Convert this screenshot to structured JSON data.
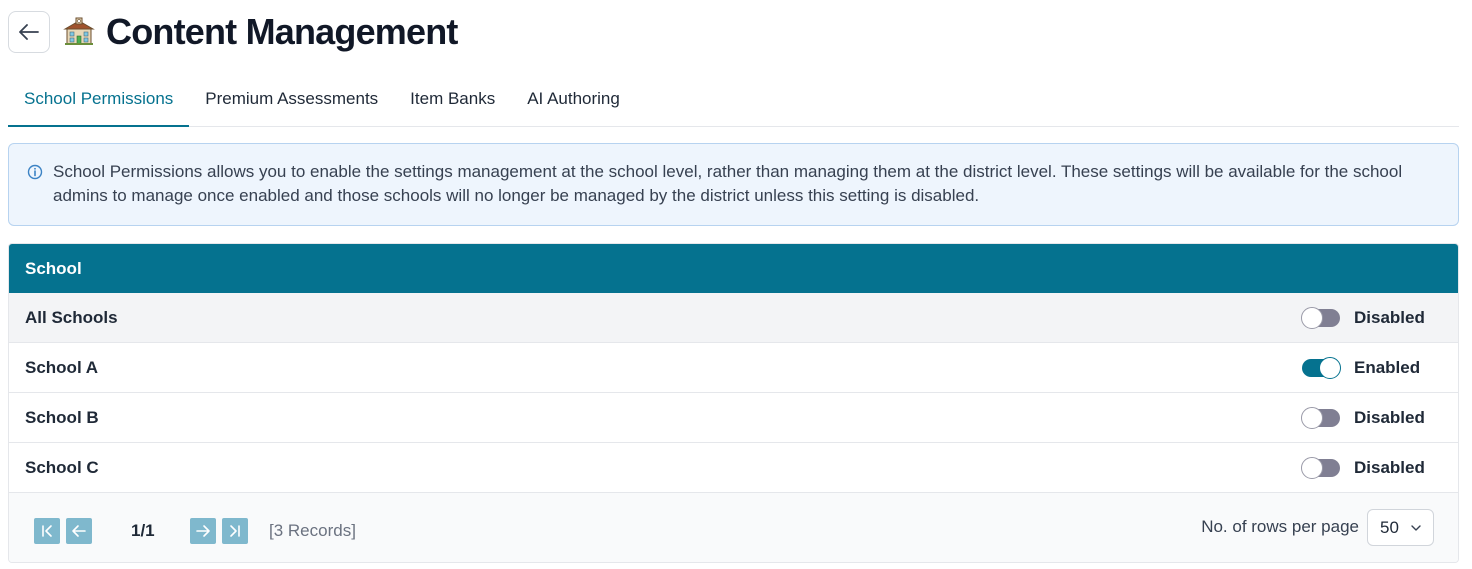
{
  "header": {
    "title": "Content Management",
    "back_icon": "arrow-left-icon",
    "title_icon": "school-building-icon"
  },
  "tabs": [
    {
      "label": "School Permissions",
      "active": true
    },
    {
      "label": "Premium Assessments",
      "active": false
    },
    {
      "label": "Item Banks",
      "active": false
    },
    {
      "label": "AI Authoring",
      "active": false
    }
  ],
  "info": {
    "text": "School Permissions allows you to enable the settings management at the school level, rather than managing them at the district level. These settings will be available for the school admins to manage once enabled and those schools will no longer be managed by the district unless this setting is disabled."
  },
  "table": {
    "column_header": "School",
    "rows": [
      {
        "name": "All Schools",
        "enabled": false,
        "status": "Disabled"
      },
      {
        "name": "School A",
        "enabled": true,
        "status": "Enabled"
      },
      {
        "name": "School B",
        "enabled": false,
        "status": "Disabled"
      },
      {
        "name": "School C",
        "enabled": false,
        "status": "Disabled"
      }
    ]
  },
  "pagination": {
    "page": "1/1",
    "records": "[3 Records]",
    "rows_per_page_label": "No. of rows per page",
    "rows_per_page_value": "50"
  },
  "colors": {
    "accent": "#05728f",
    "toggle_off": "#807f93",
    "pager_button": "#7fb8cd",
    "info_bg": "#eef5fd",
    "info_border": "#b7d3f0"
  }
}
